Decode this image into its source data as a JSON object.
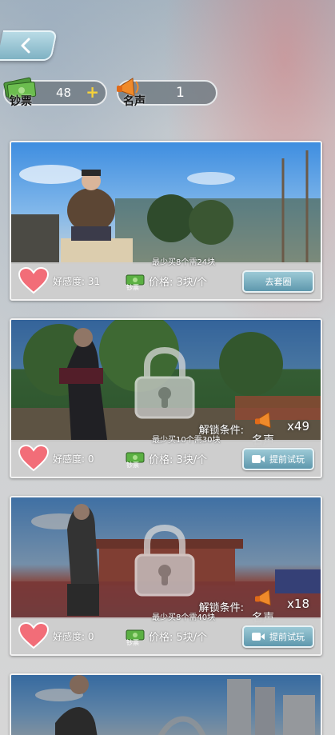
{
  "header": {
    "back_icon": "chevron-left-icon"
  },
  "resources": {
    "money": {
      "label": "钞票",
      "value": "48",
      "plus": "+",
      "icon": "cash-icon"
    },
    "fame": {
      "label": "名声",
      "value": "1",
      "icon": "megaphone-icon"
    }
  },
  "cards": [
    {
      "favor_label": "好感度:",
      "favor_value": "31",
      "cash_label": "钞票",
      "price": "价格: 3块/个",
      "min_buy": "最少买8个需24块",
      "button": "去套圈",
      "locked": false
    },
    {
      "favor_label": "好感度:",
      "favor_value": "0",
      "cash_label": "钞票",
      "price": "价格: 3块/个",
      "min_buy": "最少买10个需30块",
      "button": "提前试玩",
      "locked": true,
      "unlock_label": "解锁条件:",
      "unlock_fame": "名声",
      "unlock_count": "x49"
    },
    {
      "favor_label": "好感度:",
      "favor_value": "0",
      "cash_label": "钞票",
      "price": "价格: 5块/个",
      "min_buy": "最少买8个需40块",
      "button": "提前试玩",
      "locked": true,
      "unlock_label": "解锁条件:",
      "unlock_fame": "名声",
      "unlock_count": "x18"
    }
  ],
  "colors": {
    "accent": "#6aa6b9",
    "heart": "#f26d78",
    "plus": "#f6d23a"
  }
}
